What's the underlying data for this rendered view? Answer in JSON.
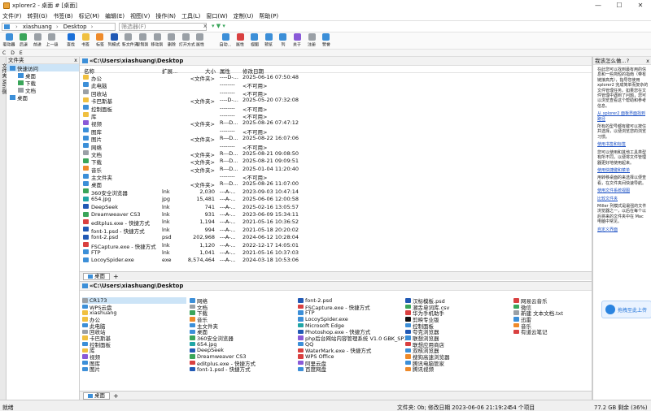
{
  "window": {
    "title": "xplorer2 - 桌面 # [桌面]",
    "minimize": "—",
    "maximize": "☐",
    "close": "✕"
  },
  "menu": [
    "文件(F)",
    "转到(G)",
    "书签(B)",
    "标记(M)",
    "编辑(E)",
    "视图(V)",
    "操作(N)",
    "工具(L)",
    "窗口(W)",
    "定制(U)",
    "帮助(P)"
  ],
  "address": {
    "user": "xiashuang",
    "folder": "Desktop",
    "arrow": "›",
    "filter_placeholder": "筛选器(F)",
    "filter_clear": "x",
    "filter_icons": "▾ ▼ ▾"
  },
  "toolbar": [
    {
      "label": "驱动器",
      "color": "#3c8fd8"
    },
    {
      "label": "后退",
      "color": "#3aa55a"
    },
    {
      "label": "前进",
      "color": "#9aa0a6"
    },
    {
      "label": "上一级",
      "color": "#9aa0a6"
    },
    {
      "label": "查找",
      "color": "#1a6fd8"
    },
    {
      "label": "书签",
      "color": "#f0c040"
    },
    {
      "label": "标签",
      "color": "#ee8a2a"
    },
    {
      "label": "列模式",
      "color": "#2159b5"
    },
    {
      "label": "新文件夹",
      "color": "#9aa0a6"
    },
    {
      "label": "复制到",
      "color": "#9aa0a6"
    },
    {
      "label": "移动到",
      "color": "#9aa0a6"
    },
    {
      "label": "删除",
      "color": "#9aa0a6"
    },
    {
      "label": "打开方式",
      "color": "#9aa0a6"
    },
    {
      "label": "属性",
      "color": "#9aa0a6"
    },
    {
      "label": "自动...",
      "color": "#3c8fd8"
    },
    {
      "label": "属性",
      "color": "#d94040"
    },
    {
      "label": "视图",
      "color": "#3c8fd8"
    },
    {
      "label": "预览",
      "color": "#3c8fd8"
    },
    {
      "label": "列",
      "color": "#3c8fd8"
    },
    {
      "label": "关于",
      "color": "#8a5ad8"
    },
    {
      "label": "注册",
      "color": "#9aa0a6"
    },
    {
      "label": "赞誉",
      "color": "#3c8fd8"
    }
  ],
  "drives": [
    "C",
    "D",
    "E"
  ],
  "tree": {
    "title": "文件夹",
    "close": "x",
    "items": [
      {
        "label": "快速访问",
        "level": 0,
        "color": "#3c8fd8",
        "selected": true
      },
      {
        "label": "桌面",
        "level": 1,
        "color": "#3c8fd8"
      },
      {
        "label": "下载",
        "level": 1,
        "color": "#3aa55a"
      },
      {
        "label": "文档",
        "level": 1,
        "color": "#9aa0a6"
      },
      {
        "label": "桌面",
        "level": 0,
        "color": "#3c8fd8"
      }
    ],
    "vertical_tab": "文件夹 Mini侧"
  },
  "list": {
    "path": "«C:\\Users\\xiashuang\\Desktop",
    "columns": {
      "name": "名称",
      "ext": "扩展...",
      "size": "大小",
      "attr": "属性",
      "date": "修改日期"
    },
    "rows": [
      {
        "name": "办公",
        "ext": "",
        "size": "<文件夹>",
        "attr": "----D-...",
        "date": "2025-06-16 07:50:48",
        "color": "#f0c040"
      },
      {
        "name": "此电脑",
        "ext": "",
        "size": "",
        "attr": "--------",
        "date": "<不可用>",
        "color": "#3c8fd8"
      },
      {
        "name": "回收站",
        "ext": "",
        "size": "",
        "attr": "--------",
        "date": "<不可用>",
        "color": "#9aa0a6"
      },
      {
        "name": "卡巴斯基",
        "ext": "",
        "size": "<文件夹>",
        "attr": "----D-...",
        "date": "2025-05-20 07:32:08",
        "color": "#f0c040"
      },
      {
        "name": "控制面板",
        "ext": "",
        "size": "",
        "attr": "--------",
        "date": "<不可用>",
        "color": "#3c8fd8"
      },
      {
        "name": "库",
        "ext": "",
        "size": "",
        "attr": "--------",
        "date": "<不可用>",
        "color": "#f0c040"
      },
      {
        "name": "视频",
        "ext": "",
        "size": "<文件夹>",
        "attr": "R---D...",
        "date": "2025-08-26 07:47:12",
        "color": "#8a5ad8"
      },
      {
        "name": "图库",
        "ext": "",
        "size": "",
        "attr": "--------",
        "date": "<不可用>",
        "color": "#3c8fd8"
      },
      {
        "name": "图片",
        "ext": "",
        "size": "<文件夹>",
        "attr": "R---D...",
        "date": "2025-08-22 16:07:06",
        "color": "#3c8fd8"
      },
      {
        "name": "网络",
        "ext": "",
        "size": "",
        "attr": "--------",
        "date": "<不可用>",
        "color": "#3c8fd8"
      },
      {
        "name": "文档",
        "ext": "",
        "size": "<文件夹>",
        "attr": "R---D...",
        "date": "2025-08-21 09:08:50",
        "color": "#9aa0a6"
      },
      {
        "name": "下载",
        "ext": "",
        "size": "<文件夹>",
        "attr": "R---D...",
        "date": "2025-08-21 09:09:51",
        "color": "#3aa55a"
      },
      {
        "name": "音乐",
        "ext": "",
        "size": "<文件夹>",
        "attr": "R---D...",
        "date": "2025-01-04 11:20:40",
        "color": "#ee8a2a"
      },
      {
        "name": "主文件夹",
        "ext": "",
        "size": "",
        "attr": "--------",
        "date": "<不可用>",
        "color": "#3c8fd8"
      },
      {
        "name": "桌面",
        "ext": "",
        "size": "<文件夹>",
        "attr": "R---D...",
        "date": "2025-08-26 11:07:00",
        "color": "#3c8fd8"
      },
      {
        "name": "360安全浏览器",
        "ext": "lnk",
        "size": "2,030",
        "attr": "---A-...",
        "date": "2023-09-03 10:47:14",
        "color": "#3aa55a"
      },
      {
        "name": "654.jpg",
        "ext": "jpg",
        "size": "15,481",
        "attr": "---A-...",
        "date": "2025-06-06 12:00:58",
        "color": "#1fa5a5"
      },
      {
        "name": "DeepSeek",
        "ext": "lnk",
        "size": "741",
        "attr": "---A-...",
        "date": "2025-02-16 13:05:57",
        "color": "#2159b5"
      },
      {
        "name": "Dreamweaver CS3",
        "ext": "lnk",
        "size": "931",
        "attr": "---A-...",
        "date": "2023-06-09 15:34:11",
        "color": "#3aa55a"
      },
      {
        "name": "editplus.exe - 快捷方式",
        "ext": "lnk",
        "size": "1,194",
        "attr": "---A-...",
        "date": "2021-05-16 10:36:52",
        "color": "#d94040"
      },
      {
        "name": "font-1.psd - 快捷方式",
        "ext": "lnk",
        "size": "994",
        "attr": "---A-...",
        "date": "2021-05-18 20:20:02",
        "color": "#2159b5"
      },
      {
        "name": "font-2.psd",
        "ext": "psd",
        "size": "202,968",
        "attr": "---A-...",
        "date": "2024-06-12 10:28:04",
        "color": "#2159b5"
      },
      {
        "name": "FSCapture.exe - 快捷方式",
        "ext": "lnk",
        "size": "1,120",
        "attr": "---A-...",
        "date": "2022-12-17 14:05:01",
        "color": "#d94040"
      },
      {
        "name": "FTP",
        "ext": "lnk",
        "size": "1,041",
        "attr": "---A-...",
        "date": "2021-05-16 10:37:03",
        "color": "#3c8fd8"
      },
      {
        "name": "LocoySpider.exe",
        "ext": "exe",
        "size": "8,574,464",
        "attr": "---A-...",
        "date": "2024-03-18 10:53:06",
        "color": "#3c8fd8"
      }
    ],
    "tab_label": "桌面",
    "tab_plus": "+"
  },
  "icons_view": {
    "path": "«C:\\Users\\xiashuang\\Desktop",
    "columns": [
      [
        {
          "n": "CR173",
          "c": "#9aa0a6",
          "sel": true
        },
        {
          "n": "WPS云盘",
          "c": "#3c8fd8"
        },
        {
          "n": "xiashuang",
          "c": "#f0c040"
        },
        {
          "n": "办公",
          "c": "#f0c040"
        },
        {
          "n": "此电脑",
          "c": "#3c8fd8"
        },
        {
          "n": "回收站",
          "c": "#9aa0a6"
        },
        {
          "n": "卡巴斯基",
          "c": "#f0c040"
        },
        {
          "n": "控制面板",
          "c": "#3c8fd8"
        },
        {
          "n": "库",
          "c": "#f0c040"
        },
        {
          "n": "视频",
          "c": "#8a5ad8"
        },
        {
          "n": "图库",
          "c": "#3c8fd8"
        },
        {
          "n": "图片",
          "c": "#3c8fd8"
        }
      ],
      [
        {
          "n": "网络",
          "c": "#3c8fd8"
        },
        {
          "n": "文档",
          "c": "#9aa0a6"
        },
        {
          "n": "下载",
          "c": "#3aa55a"
        },
        {
          "n": "音乐",
          "c": "#ee8a2a"
        },
        {
          "n": "主文件夹",
          "c": "#3c8fd8"
        },
        {
          "n": "桌面",
          "c": "#3c8fd8"
        },
        {
          "n": "360安全浏览器",
          "c": "#3aa55a"
        },
        {
          "n": "654.jpg",
          "c": "#1fa5a5"
        },
        {
          "n": "DeepSeek",
          "c": "#2159b5"
        },
        {
          "n": "Dreamweaver CS3",
          "c": "#3aa55a"
        },
        {
          "n": "editplus.exe - 快捷方式",
          "c": "#d94040"
        },
        {
          "n": "font-1.psd - 快捷方式",
          "c": "#2159b5"
        }
      ],
      [
        {
          "n": "font-2.psd",
          "c": "#2159b5"
        },
        {
          "n": "FSCapture.exe - 快捷方式",
          "c": "#d94040"
        },
        {
          "n": "FTP",
          "c": "#3c8fd8"
        },
        {
          "n": "LocoySpider.exe",
          "c": "#3c8fd8"
        },
        {
          "n": "Microsoft Edge",
          "c": "#1fa5a5"
        },
        {
          "n": "Photoshop.exe - 快捷方式",
          "c": "#2159b5"
        },
        {
          "n": "php后台网站内容管理系统 V1.0 GBK_SP1",
          "c": "#8a5ad8"
        },
        {
          "n": "QQ",
          "c": "#3c8fd8"
        },
        {
          "n": "WaterMark.exe - 快捷方式",
          "c": "#d94040"
        },
        {
          "n": "WPS Office",
          "c": "#d94040"
        },
        {
          "n": "阿里云盘",
          "c": "#8a5ad8"
        },
        {
          "n": "百度网盘",
          "c": "#3c8fd8"
        }
      ],
      [
        {
          "n": "汉标模板.psd",
          "c": "#2159b5"
        },
        {
          "n": "潮舌单词库.csv",
          "c": "#3aa55a"
        },
        {
          "n": "华为手机助手",
          "c": "#d94040"
        },
        {
          "n": "剪映专业版",
          "c": "#111111"
        },
        {
          "n": "控制面板",
          "c": "#3c8fd8"
        },
        {
          "n": "夸克浏览器",
          "c": "#2159b5"
        },
        {
          "n": "联想浏览器",
          "c": "#3c8fd8"
        },
        {
          "n": "联想应用商店",
          "c": "#d94040"
        },
        {
          "n": "双核浏览器",
          "c": "#3c8fd8"
        },
        {
          "n": "搜狗高速浏览器",
          "c": "#ee8a2a"
        },
        {
          "n": "腾讯电脑管家",
          "c": "#3c8fd8"
        },
        {
          "n": "腾讯视频",
          "c": "#ee8a2a"
        }
      ],
      [
        {
          "n": "网易云音乐",
          "c": "#d94040"
        },
        {
          "n": "微信",
          "c": "#3aa55a"
        },
        {
          "n": "新建 文本文档.txt",
          "c": "#9aa0a6"
        },
        {
          "n": "迅雷",
          "c": "#3c8fd8"
        },
        {
          "n": "音乐",
          "c": "#ee8a2a"
        },
        {
          "n": "有道云笔记",
          "c": "#d94040"
        }
      ]
    ],
    "tab_label": "桌面",
    "tab_plus": "+"
  },
  "help": {
    "title": "我该怎么做...?",
    "close": "x",
    "p1": "在此您可以找到最有用的信息和一些简短的指南（带有链接高亮），指导您使用 xplorer2 完成简单而复杂的文件管理任务。如果您在文件管理中遇到了问题，您可以浏览查看这个帮助和参考信息。",
    "links": [
      "从 xplorer2 面板界面找到路径",
      "使用书签和标签",
      "使用快捷键和菜单",
      "使用文件系统视图",
      "比较文件夹",
      "自定义界面"
    ],
    "p2": "所有的型号都有键可以按住并选择，以便浏览您的浏览习惯。",
    "p3": "您可以使用和其他工具类型有所不同，以便将文件管理器更好地使用起来。",
    "p4": "用转移桌面的来选择以便查看，在文件夹间快速导航。",
    "p5": "Miller 列模式是最强的文件浏览器之一，以后在每个以后将来的文件夹中在 Mac 电脑中常见。",
    "cloud": "拖拽至此上传"
  },
  "status": {
    "left": "就绪",
    "info": "文件夹: 0b; 修改日期 2023-06-06 21:19:24",
    "count": "54 个项目",
    "disk": "77.2 GB 剩余 (36%)"
  }
}
